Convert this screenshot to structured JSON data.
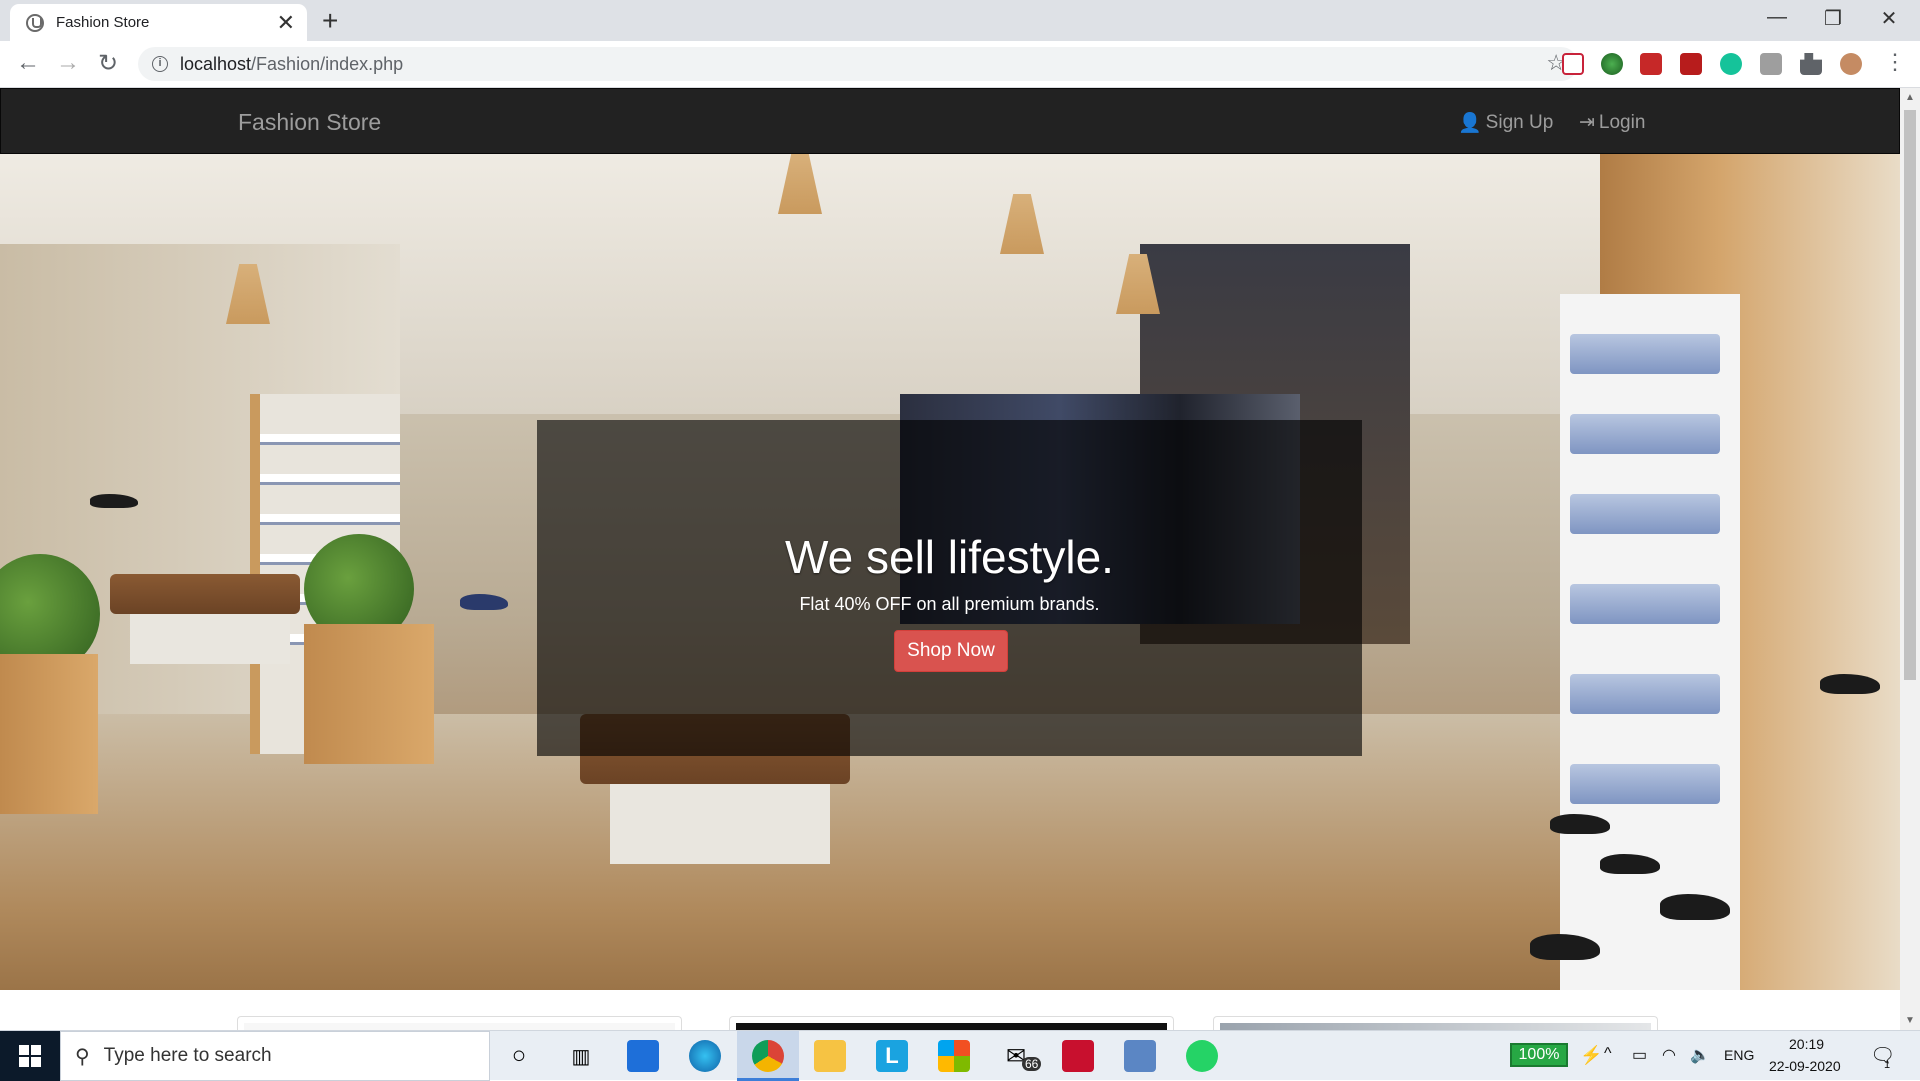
{
  "browser": {
    "tab_title": "Fashion Store",
    "tab_close": "✕",
    "new_tab": "+",
    "url_host": "localhost",
    "url_path": "/Fashion/index.php",
    "window_minimize": "—",
    "window_restore": "❐",
    "window_close": "✕"
  },
  "navbar": {
    "brand": "Fashion Store",
    "signup_label": "Sign Up",
    "login_label": "Login"
  },
  "hero": {
    "title": "We sell lifestyle.",
    "subtitle": "Flat 40% OFF on all premium brands.",
    "button_label": "Shop Now"
  },
  "taskbar": {
    "search_placeholder": "Type here to search",
    "battery": "100%",
    "language": "ENG",
    "time": "20:19",
    "date": "22-09-2020",
    "mail_badge": "66",
    "notification_badge": "1"
  },
  "colors": {
    "navbar_bg": "#222222",
    "navbar_text": "#9d9d9d",
    "button_red": "#d9534f",
    "caption_overlay": "rgba(0,0,0,0.62)"
  }
}
